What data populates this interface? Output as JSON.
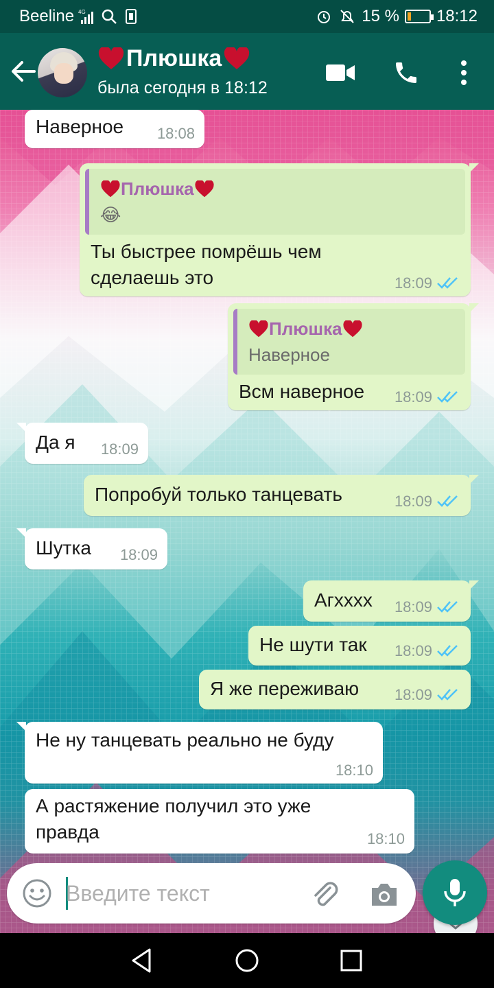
{
  "status_bar": {
    "carrier": "Beeline",
    "network": "4G",
    "battery_percent": "15 %",
    "battery_level": 0.15,
    "time": "18:12",
    "colors": {
      "bg": "#054d44",
      "battery_fill": "#f5a623"
    }
  },
  "header": {
    "name": "Плюшка",
    "name_decoration_icon": "red-heart-icon",
    "status": "была сегодня в 18:12",
    "icons": [
      "back-arrow-icon",
      "video-call-icon",
      "phone-icon",
      "more-vert-icon"
    ],
    "color": "#075e54"
  },
  "messages": [
    {
      "direction": "in",
      "text": "Наверное",
      "time": "18:08"
    },
    {
      "direction": "out",
      "quote_name": "Плюшка",
      "quote_text": "😂",
      "text_line1": "Ты быстрее помрёшь чем",
      "text_line2": "сделаешь это",
      "time": "18:09",
      "read": true
    },
    {
      "direction": "out",
      "quote_name": "Плюшка",
      "quote_text": "Наверное",
      "text": "Всм наверное",
      "time": "18:09",
      "read": true
    },
    {
      "direction": "in",
      "text": "Да я",
      "time": "18:09"
    },
    {
      "direction": "out",
      "text": "Попробуй только танцевать",
      "time": "18:09",
      "read": true
    },
    {
      "direction": "in",
      "text": "Шутка",
      "time": "18:09"
    },
    {
      "direction": "out",
      "text": "Агхххх",
      "time": "18:09",
      "read": true
    },
    {
      "direction": "out",
      "text": "Не шути так",
      "time": "18:09",
      "read": true
    },
    {
      "direction": "out",
      "text": "Я же переживаю",
      "time": "18:09",
      "read": true
    },
    {
      "direction": "in",
      "text": "Не ну танцевать реально не буду",
      "time": "18:10"
    },
    {
      "direction": "in",
      "text_line1": "А растяжение получил это уже",
      "text_line2": "правда",
      "time": "18:10"
    }
  ],
  "composer": {
    "placeholder": "Введите текст",
    "icons": [
      "emoji-icon",
      "paperclip-icon",
      "camera-icon",
      "mic-icon"
    ],
    "accent": "#128c7e"
  },
  "colors": {
    "incoming_bubble": "#ffffff",
    "outgoing_bubble": "#e2f6c8",
    "quote_bar": "#a77cc5",
    "quote_name": "#a565ad",
    "read_ticks": "#4fc3f7"
  },
  "nav_icons": [
    "back-triangle-icon",
    "home-circle-icon",
    "recents-square-icon"
  ]
}
